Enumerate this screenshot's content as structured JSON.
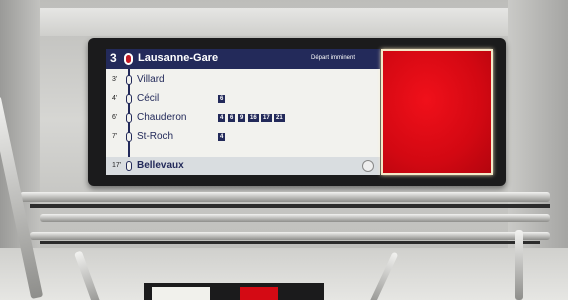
{
  "display": {
    "line_number": "3",
    "destination": "Lausanne-Gare",
    "status": "Départ imminent",
    "stops": [
      {
        "time": "3'",
        "name": "Villard",
        "connections": []
      },
      {
        "time": "4'",
        "name": "Cécil",
        "connections": [
          "6"
        ]
      },
      {
        "time": "6'",
        "name": "Chauderon",
        "connections": [
          "4",
          "6",
          "9",
          "16",
          "17",
          "21"
        ]
      },
      {
        "time": "7'",
        "name": "St-Roch",
        "connections": [
          "4"
        ]
      }
    ],
    "final_stop": {
      "time": "17'",
      "name": "Bellevaux"
    },
    "accent_color": "#232a5a",
    "ad_panel_color": "#d30812"
  }
}
